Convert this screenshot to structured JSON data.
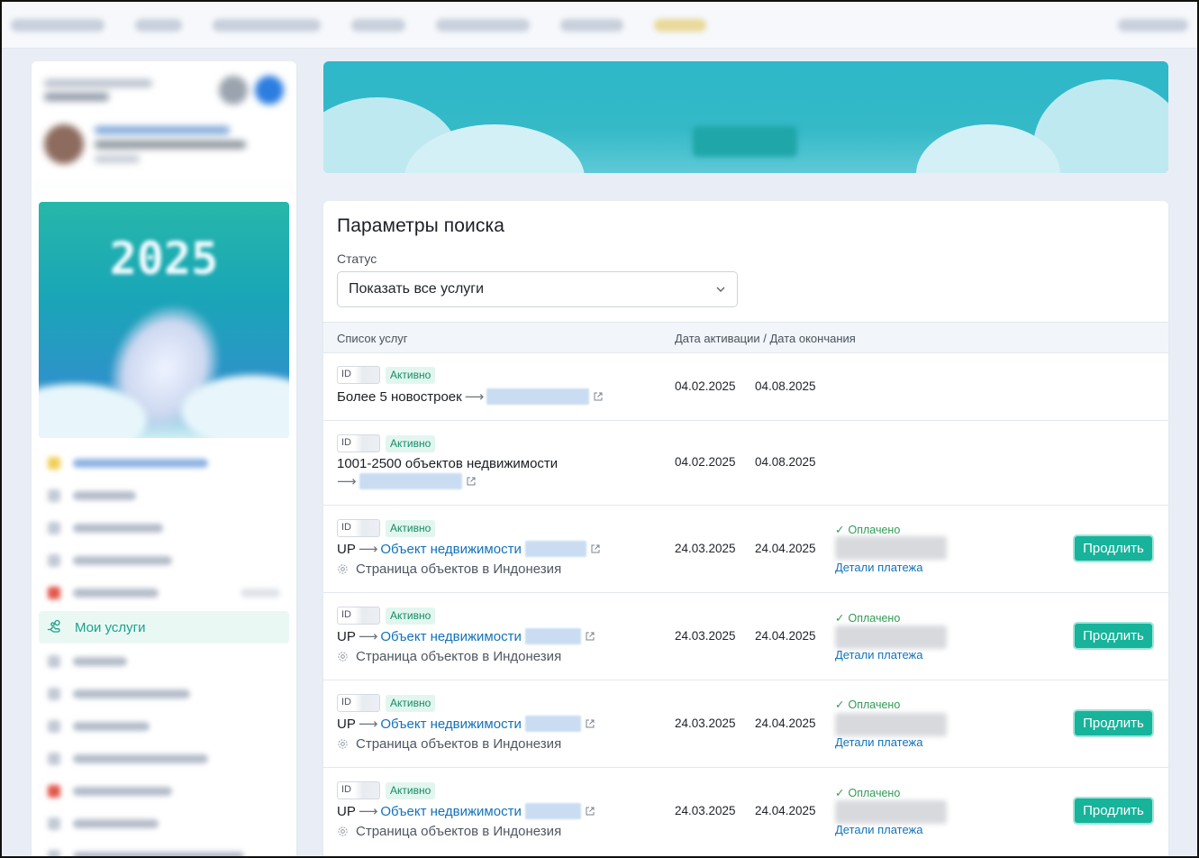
{
  "sidebar": {
    "active_item": {
      "label": "Мои услуги",
      "icon": "hand-coins-icon"
    },
    "promo_year": "2025"
  },
  "filters": {
    "heading": "Параметры поиска",
    "status_label": "Статус",
    "status_value": "Показать все услуги"
  },
  "table": {
    "col_services": "Список услуг",
    "col_dates": "Дата активации / Дата окончания",
    "rows": [
      {
        "id_label": "ID",
        "status": "Активно",
        "prefix": "",
        "title": "Более 5 новостроек",
        "activation": "04.02.2025",
        "expiry": "04.08.2025"
      },
      {
        "id_label": "ID",
        "status": "Активно",
        "prefix": "",
        "title": "1001-2500 объектов недвижимости",
        "activation": "04.02.2025",
        "expiry": "04.08.2025"
      },
      {
        "id_label": "ID",
        "status": "Активно",
        "prefix": "UP",
        "title": "Объект недвижимости",
        "subtitle": "Страница объектов в Индонезия",
        "activation": "24.03.2025",
        "expiry": "24.04.2025",
        "payment_status": "Оплачено",
        "payment_link": "Детали платежа",
        "action": "Продлить"
      },
      {
        "id_label": "ID",
        "status": "Активно",
        "prefix": "UP",
        "title": "Объект недвижимости",
        "subtitle": "Страница объектов в Индонезия",
        "activation": "24.03.2025",
        "expiry": "24.04.2025",
        "payment_status": "Оплачено",
        "payment_link": "Детали платежа",
        "action": "Продлить"
      },
      {
        "id_label": "ID",
        "status": "Активно",
        "prefix": "UP",
        "title": "Объект недвижимости",
        "subtitle": "Страница объектов в Индонезия",
        "activation": "24.03.2025",
        "expiry": "24.04.2025",
        "payment_status": "Оплачено",
        "payment_link": "Детали платежа",
        "action": "Продлить"
      },
      {
        "id_label": "ID",
        "status": "Активно",
        "prefix": "UP",
        "title": "Объект недвижимости",
        "subtitle": "Страница объектов в Индонезия",
        "activation": "24.03.2025",
        "expiry": "24.04.2025",
        "payment_status": "Оплачено",
        "payment_link": "Детали платежа",
        "action": "Продлить"
      }
    ]
  },
  "colors": {
    "accent": "#17b39b",
    "link": "#1372b9",
    "paid": "#2f9a55",
    "badge_bg": "#e2f6ef"
  }
}
